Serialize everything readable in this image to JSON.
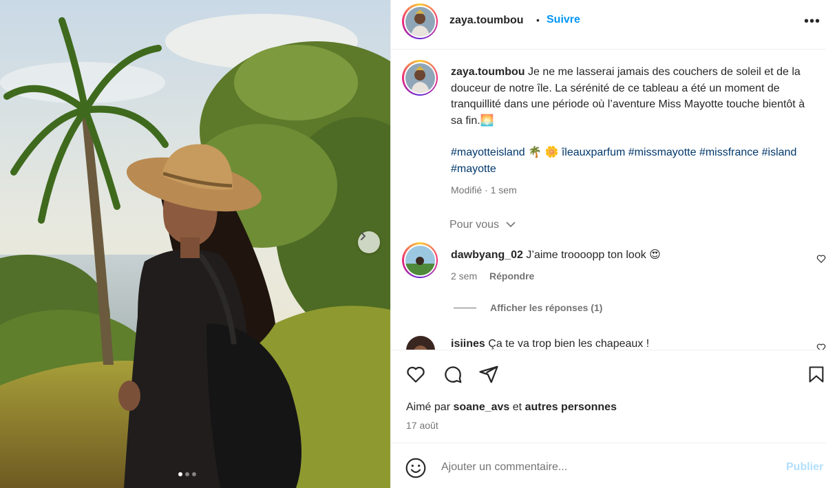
{
  "post": {
    "username": "zaya.toumbou",
    "separator": "•",
    "follow_label": "Suivre",
    "more_label": "•••",
    "caption_text": "Je ne me lasserai jamais des couchers de soleil et de la douceur de notre île. La sérénité de ce tableau a été un moment de tranquillité dans une période où l’aventure Miss Mayotte touche bientôt à sa fin.🌅",
    "hashtags": [
      {
        "text": "#mayotteisland"
      },
      {
        "text": "🌴 🌼"
      },
      {
        "text": "îleauxparfum"
      },
      {
        "text": "#missmayotte"
      },
      {
        "text": "#missfrance"
      },
      {
        "text": "#island"
      },
      {
        "text": "#mayotte"
      }
    ],
    "edited_label": "Modifié · 1 sem",
    "for_you_label": "Pour vous"
  },
  "photo": {
    "carousel_index": 1,
    "carousel_total": 3,
    "next_icon": "chevron-right-icon"
  },
  "comments": [
    {
      "username": "dawbyang_02",
      "text": "J’aime troooopp ton look 😍",
      "time": "2 sem",
      "reply_label": "Répondre",
      "show_replies_label": "Afficher les réponses (1)"
    },
    {
      "username": "isiines",
      "text": "Ça te va trop bien les chapeaux !"
    }
  ],
  "actions": {
    "icons": [
      "heart-icon",
      "comment-icon",
      "share-icon",
      "bookmark-icon"
    ],
    "liked_by_prefix": "Aimé par",
    "liked_by_user": "soane_avs",
    "liked_by_and": "et",
    "liked_by_others": "autres personnes",
    "date": "17 août"
  },
  "composer": {
    "placeholder": "Ajouter un commentaire...",
    "publish_label": "Publier"
  },
  "colors": {
    "accent": "#0095f6",
    "hashtag": "#00376b",
    "secondary_text": "#737373",
    "publish_disabled": "#b2dffc"
  }
}
